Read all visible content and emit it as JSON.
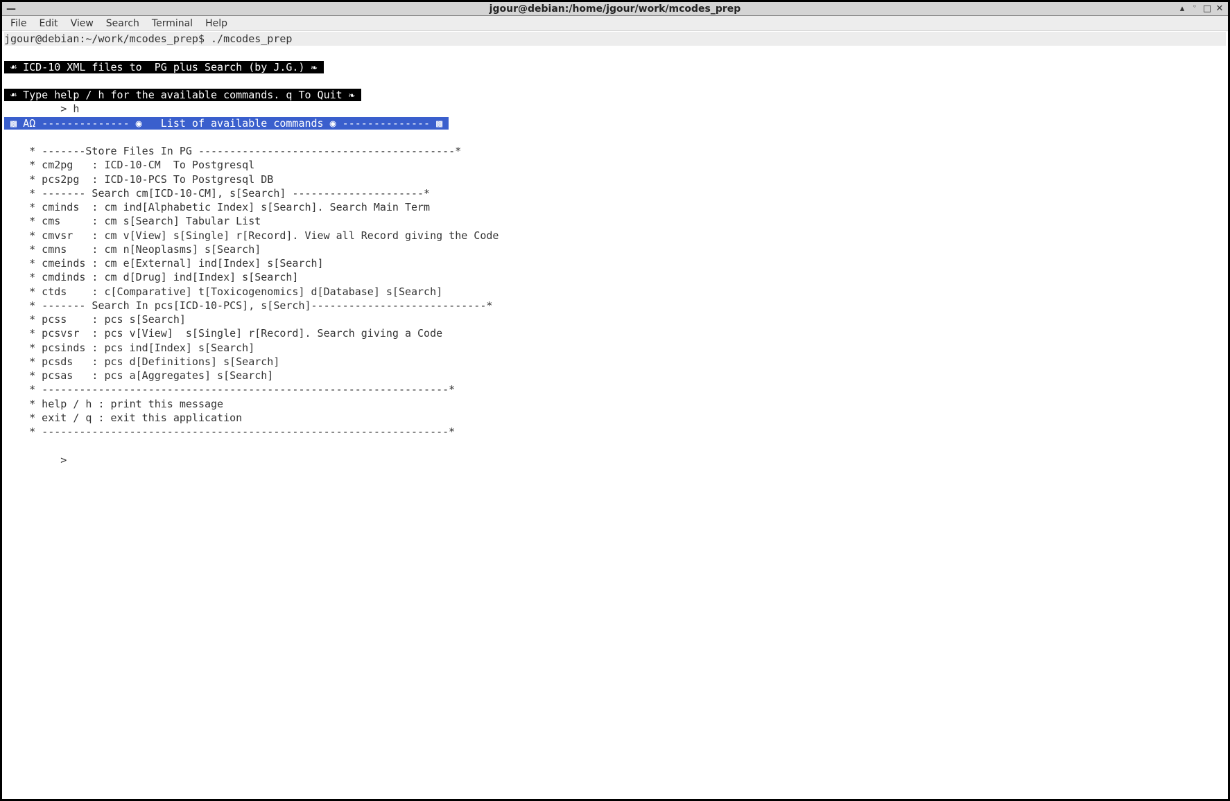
{
  "window": {
    "title": "jgour@debian:/home/jgour/work/mcodes_prep"
  },
  "menubar": {
    "items": [
      "File",
      "Edit",
      "View",
      "Search",
      "Terminal",
      "Help"
    ]
  },
  "terminal": {
    "prompt_line": "jgour@debian:~/work/mcodes_prep$ ./mcodes_prep",
    "banner1": " ☙ ICD-10 XML files to  PG plus Search (by J.G.) ❧ ",
    "banner2": " ☙ Type help / h for the available commands. q To Quit ❧ ",
    "input1": "         > h",
    "list_header": " ▩ ΑΩ -------------- ◉   List of available commands ◉ -------------- ▩ ",
    "help_lines": [
      "",
      "    * -------Store Files In PG -----------------------------------------*",
      "    * cm2pg   : ICD-10-CM  To Postgresql",
      "    * pcs2pg  : ICD-10-PCS To Postgresql DB",
      "    * ------- Search cm[ICD-10-CM], s[Search] ---------------------*",
      "    * cminds  : cm ind[Alphabetic Index] s[Search]. Search Main Term",
      "    * cms     : cm s[Search] Tabular List",
      "    * cmvsr   : cm v[View] s[Single] r[Record]. View all Record giving the Code",
      "    * cmns    : cm n[Neoplasms] s[Search]",
      "    * cmeinds : cm e[External] ind[Index] s[Search]",
      "    * cmdinds : cm d[Drug] ind[Index] s[Search]",
      "    * ctds    : c[Comparative] t[Toxicogenomics] d[Database] s[Search]",
      "    * ------- Search In pcs[ICD-10-PCS], s[Serch]----------------------------*",
      "    * pcss    : pcs s[Search]",
      "    * pcsvsr  : pcs v[View]  s[Single] r[Record]. Search giving a Code",
      "    * pcsinds : pcs ind[Index] s[Search]",
      "    * pcsds   : pcs d[Definitions] s[Search]",
      "    * pcsas   : pcs a[Aggregates] s[Search]",
      "    * -----------------------------------------------------------------*",
      "    * help / h : print this message",
      "    * exit / q : exit this application",
      "    * -----------------------------------------------------------------*",
      "",
      "         > "
    ]
  }
}
